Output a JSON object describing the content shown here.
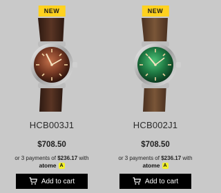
{
  "products": [
    {
      "badge": "NEW",
      "sku": "HCB003J1",
      "price": "$708.50",
      "installment_prefix": "or 3 payments of",
      "installment_amount": "$236.17",
      "installment_suffix": "with",
      "provider": "atome",
      "provider_mark": "A",
      "cart_label": "Add to cart",
      "dial_color": "#7a3b25",
      "strap_color": "#4a2b1f"
    },
    {
      "badge": "NEW",
      "sku": "HCB002J1",
      "price": "$708.50",
      "installment_prefix": "or 3 payments of",
      "installment_amount": "$236.17",
      "installment_suffix": "with",
      "provider": "atome",
      "provider_mark": "A",
      "cart_label": "Add to cart",
      "dial_color": "#1f7a43",
      "strap_color": "#6b4a32"
    }
  ],
  "colors": {
    "background": "#c9c9c9",
    "badge": "#ffd21f",
    "button": "#000000",
    "atome_mark": "#f2f02a"
  },
  "icons": {
    "cart": "cart-icon",
    "watch": "watch-image"
  }
}
